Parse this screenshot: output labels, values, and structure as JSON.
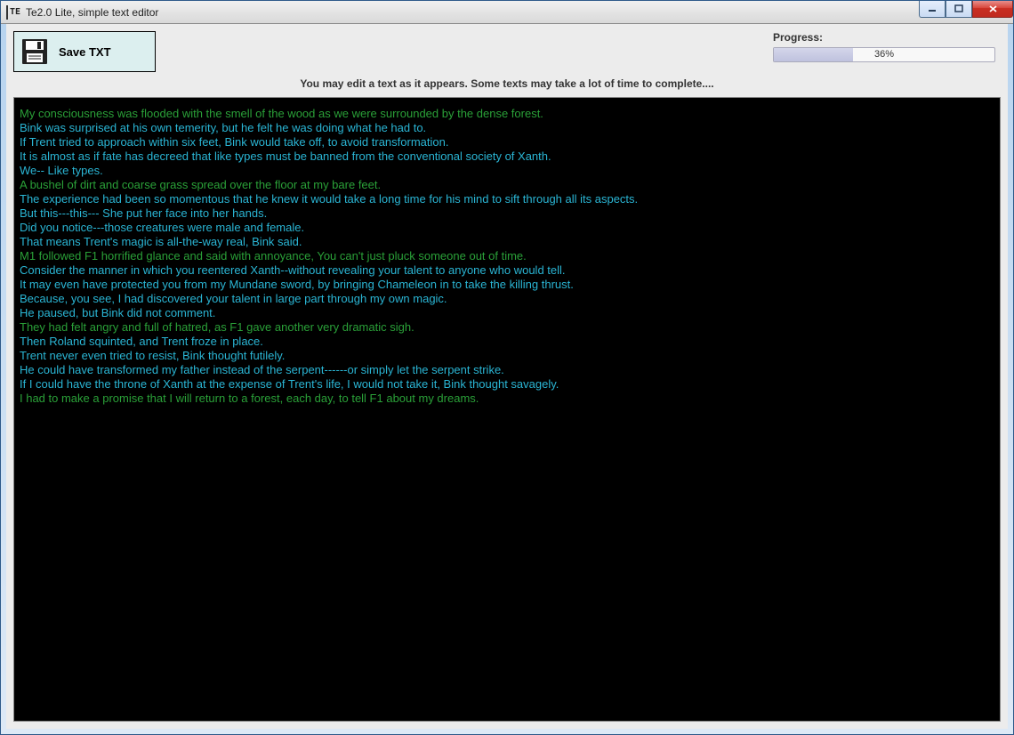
{
  "window": {
    "title": "Te2.0 Lite, simple text editor",
    "icon_label": "TE"
  },
  "toolbar": {
    "save_label": "Save TXT"
  },
  "progress": {
    "label": "Progress:",
    "percent_text": "36%",
    "percent_value": 36
  },
  "hint": "You may edit a text as it appears. Some texts may take a lot of time to complete....",
  "editor_lines": [
    {
      "text": "My consciousness was flooded with the smell of the wood as we were surrounded by the dense forest.",
      "color": 0
    },
    {
      "text": "Bink was surprised at his own temerity, but he felt he was doing what he had to.",
      "color": 1
    },
    {
      "text": "If Trent tried to approach within six feet, Bink would take off, to avoid transformation.",
      "color": 1
    },
    {
      "text": "It is almost as if fate has decreed that like types must be banned from the conventional society of Xanth.",
      "color": 1
    },
    {
      "text": "We-- Like types.",
      "color": 1
    },
    {
      "text": "A bushel of dirt and coarse grass spread over the floor at my bare feet.",
      "color": 0
    },
    {
      "text": "The experience had been so momentous that he knew it would take a long time for his mind to sift through all its aspects.",
      "color": 1
    },
    {
      "text": "But this---this--- She put her face into her hands.",
      "color": 1
    },
    {
      "text": "Did you notice---those creatures were male and female.",
      "color": 1
    },
    {
      "text": "That means Trent's magic is all-the-way real, Bink said.",
      "color": 1
    },
    {
      "text": "M1 followed F1 horrified glance and said with annoyance, You can't just pluck someone out of time.",
      "color": 0
    },
    {
      "text": "Consider the manner in which you reentered Xanth--without revealing your talent to anyone who would tell.",
      "color": 1
    },
    {
      "text": "It may even have protected you from my Mundane sword, by bringing Chameleon in to take the killing thrust.",
      "color": 1
    },
    {
      "text": "Because, you see, I had discovered your talent in large part through my own magic.",
      "color": 1
    },
    {
      "text": "He paused, but Bink did not comment.",
      "color": 1
    },
    {
      "text": "They had felt angry and full of hatred, as F1 gave another very dramatic sigh.",
      "color": 0
    },
    {
      "text": "Then Roland squinted, and Trent froze in place.",
      "color": 1
    },
    {
      "text": "Trent never even tried to resist, Bink thought futilely.",
      "color": 1
    },
    {
      "text": "He could have transformed my father instead of the serpent------or simply let the serpent strike.",
      "color": 1
    },
    {
      "text": "If I could have the throne of Xanth at the expense of Trent's life, I would not take it, Bink thought savagely.",
      "color": 1
    },
    {
      "text": "I had to make a promise that I will return to a forest, each day, to tell F1 about my dreams.",
      "color": 0
    }
  ]
}
